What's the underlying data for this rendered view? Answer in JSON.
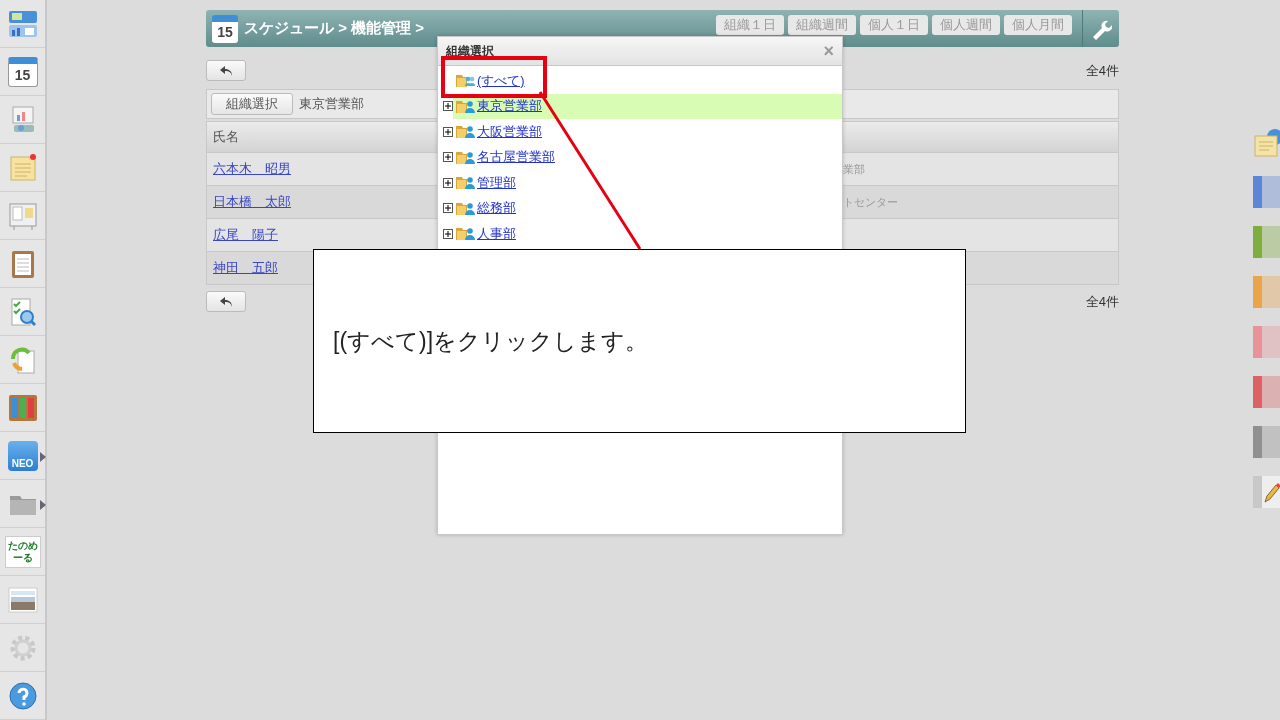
{
  "sidebar": {
    "items": [
      {
        "kind": "dashboard"
      },
      {
        "kind": "calendar",
        "label": "15"
      },
      {
        "kind": "projector"
      },
      {
        "kind": "memo"
      },
      {
        "kind": "board"
      },
      {
        "kind": "clipboard"
      },
      {
        "kind": "checklist"
      },
      {
        "kind": "cycle"
      },
      {
        "kind": "binders"
      },
      {
        "kind": "neo",
        "label": "NEO",
        "submenu": true
      },
      {
        "kind": "folder",
        "submenu": true
      },
      {
        "kind": "shop",
        "label": "たのめーる"
      },
      {
        "kind": "banner"
      },
      {
        "kind": "gear"
      },
      {
        "kind": "help"
      }
    ]
  },
  "header": {
    "calendar_day": "15",
    "title": "スケジュール > 機能管理 >",
    "buttons": [
      "組織１日",
      "組織週間",
      "個人１日",
      "個人週間",
      "個人月間"
    ]
  },
  "count_top": "全4件",
  "filter": {
    "button": "組織選択",
    "value": "東京営業部"
  },
  "table": {
    "columns": [
      "氏名"
    ],
    "rows": [
      {
        "name": "六本木　昭男",
        "column_2": "業部"
      },
      {
        "name": "日本橋　太郎",
        "column_2": "トセンター"
      },
      {
        "name": "広尾　陽子"
      },
      {
        "name": "神田　五郎"
      }
    ]
  },
  "count_bottom": "全4件",
  "dialog": {
    "title": "組織選択",
    "close": "×",
    "items": [
      {
        "kind": "all",
        "label": "(すべて)",
        "selected": false
      },
      {
        "kind": "group",
        "label": "東京営業部",
        "selected": true,
        "expanded": false
      },
      {
        "kind": "group",
        "label": "大阪営業部",
        "selected": false,
        "expanded": false
      },
      {
        "kind": "group",
        "label": "名古屋営業部",
        "selected": false,
        "expanded": false
      },
      {
        "kind": "group",
        "label": "管理部",
        "selected": false,
        "expanded": false
      },
      {
        "kind": "group",
        "label": "総務部",
        "selected": false,
        "expanded": false
      },
      {
        "kind": "group",
        "label": "人事部",
        "selected": false,
        "expanded": false
      }
    ]
  },
  "right_strip": {
    "items": [
      {
        "kind": "memo"
      },
      {
        "kind": "tab",
        "color": "#5b85d6"
      },
      {
        "kind": "tab",
        "color": "#7fae3f"
      },
      {
        "kind": "tab",
        "color": "#eaa44a"
      },
      {
        "kind": "tab",
        "color": "#e8939a"
      },
      {
        "kind": "tab",
        "color": "#dd6064"
      },
      {
        "kind": "tab",
        "color": "#909090"
      },
      {
        "kind": "pencil"
      }
    ]
  },
  "callout": {
    "text": "[(すべて)]をクリックします。"
  }
}
